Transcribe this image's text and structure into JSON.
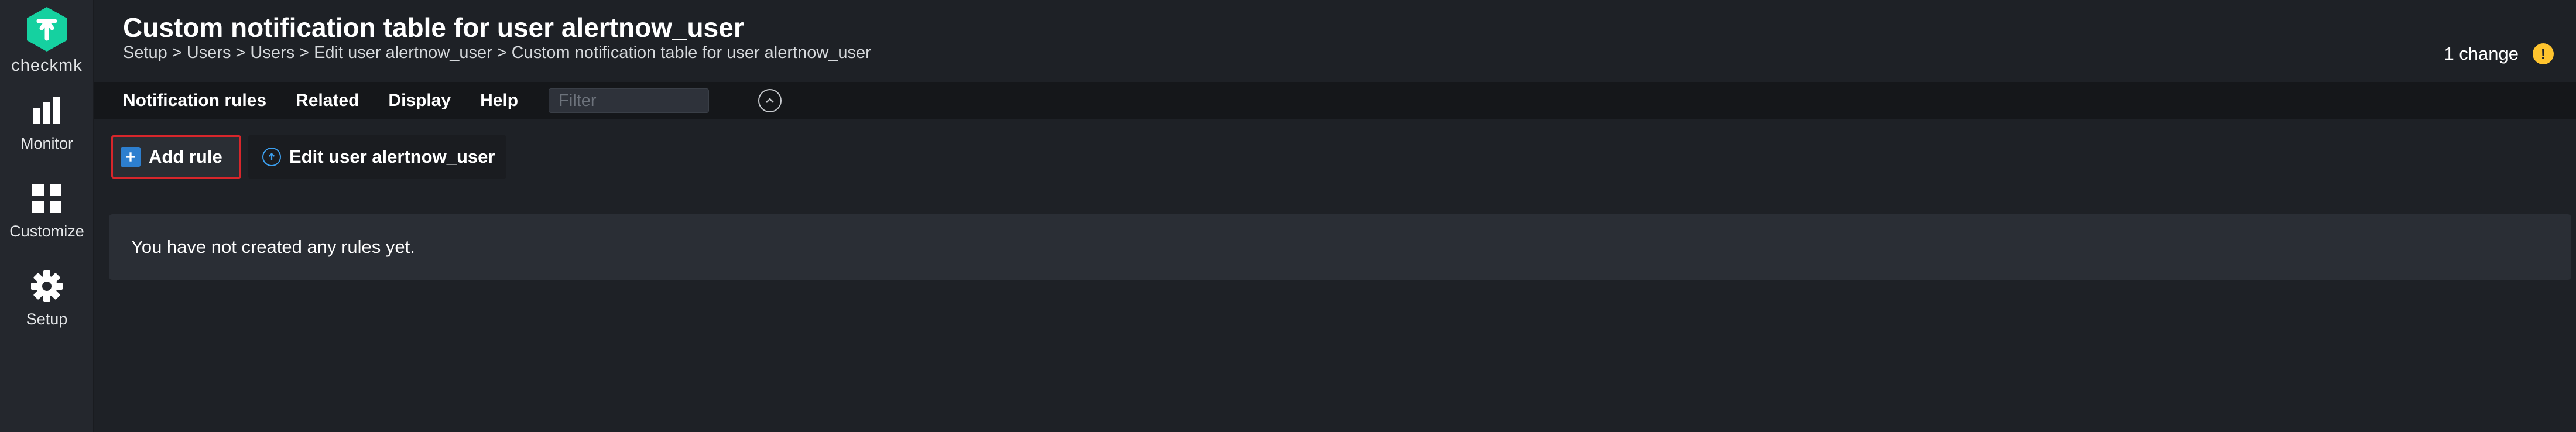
{
  "sidebar": {
    "logo_text": "checkmk",
    "items": [
      {
        "label": "Monitor",
        "icon": "monitor-icon"
      },
      {
        "label": "Customize",
        "icon": "customize-icon"
      },
      {
        "label": "Setup",
        "icon": "gear-icon"
      }
    ]
  },
  "header": {
    "title": "Custom notification table for user alertnow_user",
    "breadcrumb": [
      "Setup",
      "Users",
      "Users",
      "Edit user alertnow_user",
      "Custom notification table for user alertnow_user"
    ],
    "breadcrumb_separator": ">",
    "changes_label": "1 change",
    "changes_icon": "!"
  },
  "menubar": {
    "items": [
      "Notification rules",
      "Related",
      "Display",
      "Help"
    ],
    "filter_placeholder": "Filter"
  },
  "actions": {
    "add_rule_label": "Add rule",
    "edit_user_label": "Edit user alertnow_user"
  },
  "content": {
    "empty_message": "You have not created any rules yet."
  },
  "colors": {
    "brand": "#15d1a0",
    "accent_blue": "#2d7fcf",
    "warning": "#ffc42e",
    "highlight_red": "#d8262b"
  }
}
